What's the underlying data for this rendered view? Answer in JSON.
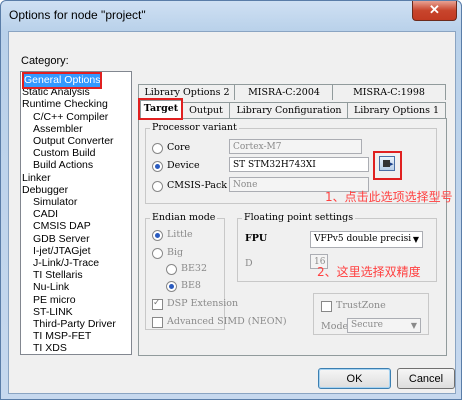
{
  "window": {
    "title": "Options for node \"project\"",
    "close_glyph": "✕"
  },
  "category": {
    "label": "Category:",
    "items": [
      "General Options",
      "Static Analysis",
      "Runtime Checking",
      "C/C++ Compiler",
      "Assembler",
      "Output Converter",
      "Custom Build",
      "Build Actions",
      "Linker",
      "Debugger",
      "Simulator",
      "CADI",
      "CMSIS DAP",
      "GDB Server",
      "I-jet/JTAGjet",
      "J-Link/J-Trace",
      "TI Stellaris",
      "Nu-Link",
      "PE micro",
      "ST-LINK",
      "Third-Party Driver",
      "TI MSP-FET",
      "TI XDS"
    ]
  },
  "tabs": {
    "row1": [
      "Library Options 2",
      "MISRA-C:2004",
      "MISRA-C:1998"
    ],
    "row2": [
      "Target",
      "Output",
      "Library Configuration",
      "Library Options 1"
    ]
  },
  "processor": {
    "group_label": "Processor variant",
    "core_label": "Core",
    "core_value": "Cortex-M7",
    "device_label": "Device",
    "device_value": "ST STM32H743XI",
    "cmsis_label": "CMSIS-Pack",
    "cmsis_value": "None",
    "selected": "Device"
  },
  "endian": {
    "group_label": "Endian mode",
    "little": "Little",
    "big": "Big",
    "be32": "BE32",
    "be8": "BE8",
    "selected": "Little"
  },
  "float": {
    "group_label": "Floating point settings",
    "fpu_label": "FPU",
    "fpu_value": "VFPv5 double precisi",
    "d_label": "D",
    "d_value": "16"
  },
  "dsp": {
    "label": "DSP Extension",
    "checked": true
  },
  "simd": {
    "label": "Advanced SIMD (NEON)",
    "checked": false
  },
  "trustzone": {
    "label": "TrustZone",
    "mode_label": "Mode",
    "mode_value": "Secure"
  },
  "annotations": {
    "step1": "1、点击此选项选择型号",
    "step2": "2、这里选择双精度"
  },
  "buttons": {
    "ok": "OK",
    "cancel": "Cancel"
  },
  "colors": {
    "selection": "#3399ff",
    "highlight": "#e02020",
    "annotation": "#ff4040"
  }
}
